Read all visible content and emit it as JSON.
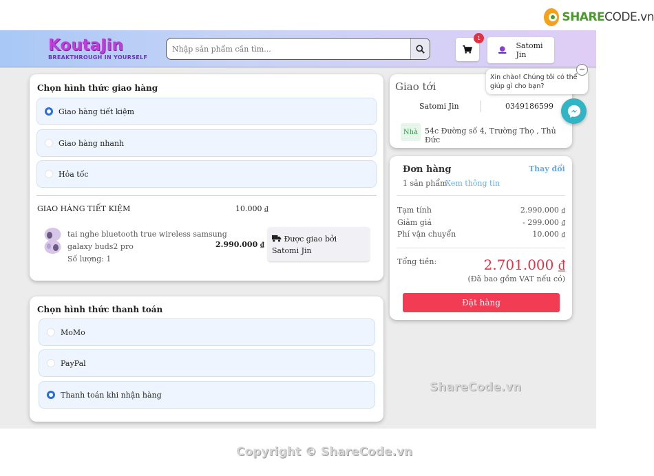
{
  "watermark": {
    "logo_main": "SHARE",
    "logo_tail": "CODE.vn",
    "mid": "ShareCode.vn",
    "bottom": "Copyright © ShareCode.vn"
  },
  "header": {
    "brand_name": "KoutaJin",
    "brand_tagline": "BREAKTHROUGH IN YOURSELF",
    "search_placeholder": "Nhập sản phẩm cần tìm...",
    "cart_count": "1",
    "user_name": "Satomi Jin"
  },
  "shipping": {
    "title": "Chọn hình thức giao hàng",
    "options": [
      {
        "label": "Giao hàng tiết kiệm",
        "selected": true
      },
      {
        "label": "Giao hàng nhanh",
        "selected": false
      },
      {
        "label": "Hỏa tốc",
        "selected": false
      }
    ],
    "selected_method": "GIAO HÀNG TIẾT KIỆM",
    "fee": "10.000 ₫",
    "product": {
      "name_line1": "tai nghe bluetooth true wireless samsung",
      "name_line2": "galaxy buds2 pro",
      "quantity": "Số lượng: 1",
      "price": "2.990.000 ₫"
    },
    "delivered_by": "Được giao bởi Satomi Jin"
  },
  "payment": {
    "title": "Chọn hình thức thanh toán",
    "options": [
      {
        "label": "MoMo",
        "selected": false
      },
      {
        "label": "PayPal",
        "selected": false
      },
      {
        "label": "Thanh toán khi nhận hàng",
        "selected": true
      }
    ]
  },
  "deliver_to": {
    "title": "Giao tới",
    "name": "Satomi Jin",
    "phone": "0349186599",
    "address_tag": "Nhà",
    "address": "54c Đường số 4, Trường Thọ , Thủ Đức"
  },
  "order": {
    "title": "Đơn hàng",
    "change_label": "Thay đổi",
    "count": "1 sản phẩm",
    "view_info": "Xem thông tin",
    "subtotal_label": "Tạm tính",
    "subtotal": "2.990.000 ₫",
    "discount_label": "Giảm giá",
    "discount": "- 299.000 ₫",
    "shipping_label": "Phí vận chuyển",
    "shipping": "10.000 ₫",
    "total_label": "Tổng tiền:",
    "total": "2.701.000 ₫",
    "vat_note": "(Đã bao gồm VAT nếu có)",
    "place_order": "Đặt hàng"
  },
  "chat": {
    "greeting": "Xin chào! Chúng tôi có thể giúp gì cho bạn?"
  },
  "colors": {
    "accent_blue": "#2a6edb",
    "order_button": "#f23c53",
    "total_red": "#e03242",
    "link_blue": "#67a9e3"
  }
}
